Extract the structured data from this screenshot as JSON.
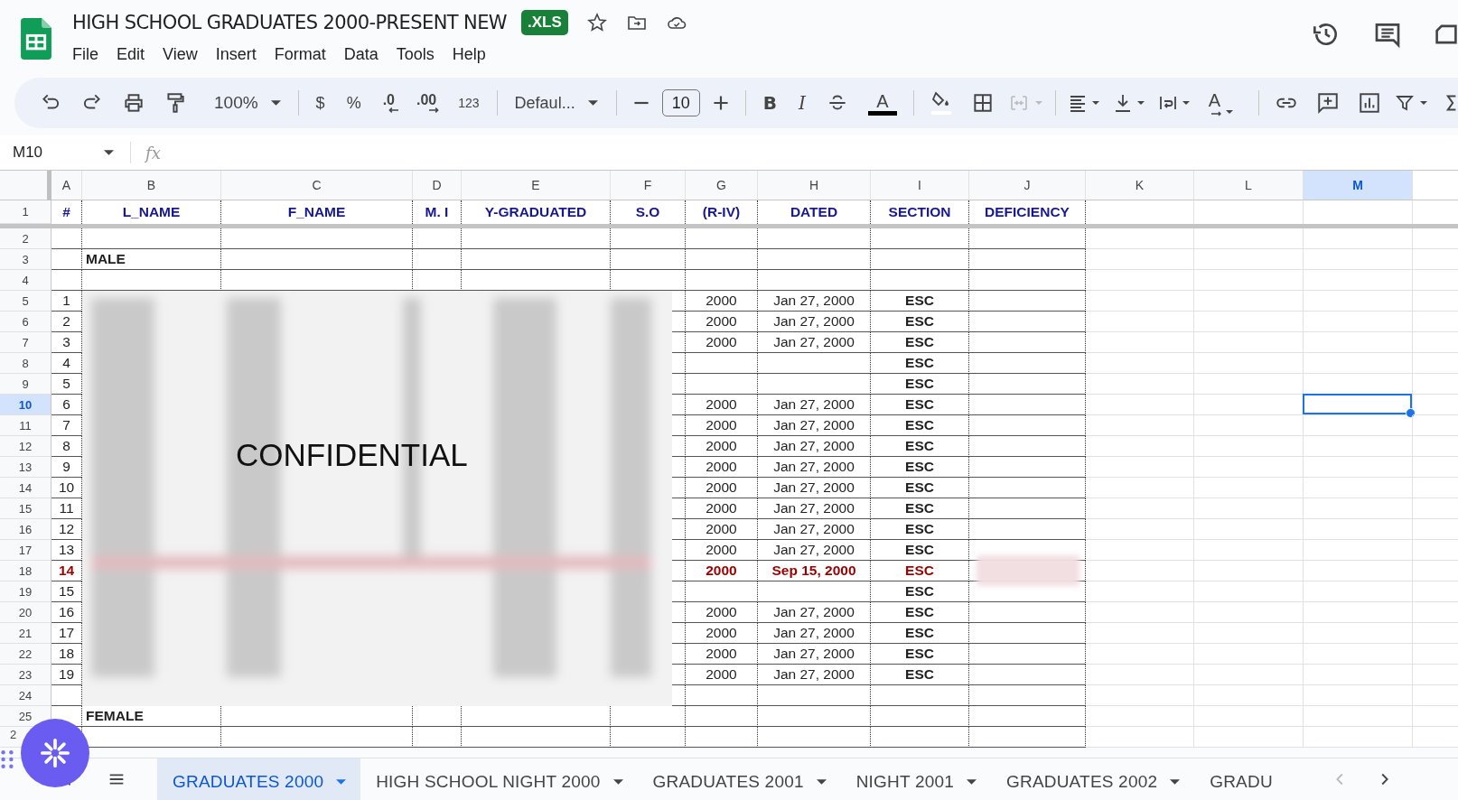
{
  "doc": {
    "title": "HIGH SCHOOL GRADUATES 2000-PRESENT NEW",
    "badge": ".XLS"
  },
  "menu": [
    "File",
    "Edit",
    "View",
    "Insert",
    "Format",
    "Data",
    "Tools",
    "Help"
  ],
  "toolbar": {
    "zoom": "100%",
    "currency": "$",
    "percent": "%",
    "dec_less": ".0",
    "dec_more": ".00",
    "number_format": "123",
    "font": "Defaul...",
    "font_size": "10",
    "bold": "B",
    "italic": "I",
    "text_color": "A",
    "rotate": "A"
  },
  "name_box": "M10",
  "fx": "fx",
  "columns": [
    {
      "letter": "A",
      "selected": false
    },
    {
      "letter": "B",
      "selected": false
    },
    {
      "letter": "C",
      "selected": false
    },
    {
      "letter": "D",
      "selected": false
    },
    {
      "letter": "E",
      "selected": false
    },
    {
      "letter": "F",
      "selected": false
    },
    {
      "letter": "G",
      "selected": false
    },
    {
      "letter": "H",
      "selected": false
    },
    {
      "letter": "I",
      "selected": false
    },
    {
      "letter": "J",
      "selected": false
    },
    {
      "letter": "K",
      "selected": false
    },
    {
      "letter": "L",
      "selected": false
    },
    {
      "letter": "M",
      "selected": true
    }
  ],
  "header_row": {
    "row": "1",
    "cells": [
      "#",
      "L_NAME",
      "F_NAME",
      "M. I",
      "Y-GRADUATED",
      "S.O",
      "(R-IV)",
      "DATED",
      "SECTION",
      "DEFICIENCY"
    ]
  },
  "rows": [
    {
      "row": "2",
      "selected": false,
      "flagged": false
    },
    {
      "row": "3",
      "selected": false,
      "flagged": false,
      "label": "MALE"
    },
    {
      "row": "4",
      "selected": false,
      "flagged": false
    },
    {
      "row": "5",
      "selected": false,
      "flagged": false,
      "num": "1",
      "year": "2000",
      "dated": "Jan 27, 2000",
      "section": "ESC"
    },
    {
      "row": "6",
      "selected": false,
      "flagged": false,
      "num": "2",
      "year": "2000",
      "dated": "Jan 27, 2000",
      "section": "ESC"
    },
    {
      "row": "7",
      "selected": false,
      "flagged": false,
      "num": "3",
      "year": "2000",
      "dated": "Jan 27, 2000",
      "section": "ESC"
    },
    {
      "row": "8",
      "selected": false,
      "flagged": false,
      "num": "4",
      "section": "ESC"
    },
    {
      "row": "9",
      "selected": false,
      "flagged": false,
      "num": "5",
      "section": "ESC"
    },
    {
      "row": "10",
      "selected": true,
      "flagged": false,
      "num": "6",
      "year": "2000",
      "dated": "Jan 27, 2000",
      "section": "ESC"
    },
    {
      "row": "11",
      "selected": false,
      "flagged": false,
      "num": "7",
      "year": "2000",
      "dated": "Jan 27, 2000",
      "section": "ESC"
    },
    {
      "row": "12",
      "selected": false,
      "flagged": false,
      "num": "8",
      "year": "2000",
      "dated": "Jan 27, 2000",
      "section": "ESC"
    },
    {
      "row": "13",
      "selected": false,
      "flagged": false,
      "num": "9",
      "year": "2000",
      "dated": "Jan 27, 2000",
      "section": "ESC"
    },
    {
      "row": "14",
      "selected": false,
      "flagged": false,
      "num": "10",
      "year": "2000",
      "dated": "Jan 27, 2000",
      "section": "ESC"
    },
    {
      "row": "15",
      "selected": false,
      "flagged": false,
      "num": "11",
      "year": "2000",
      "dated": "Jan 27, 2000",
      "section": "ESC"
    },
    {
      "row": "16",
      "selected": false,
      "flagged": false,
      "num": "12",
      "year": "2000",
      "dated": "Jan 27, 2000",
      "section": "ESC"
    },
    {
      "row": "17",
      "selected": false,
      "flagged": false,
      "num": "13",
      "year": "2000",
      "dated": "Jan 27, 2000",
      "section": "ESC"
    },
    {
      "row": "18",
      "selected": false,
      "flagged": true,
      "num": "14",
      "year": "2000",
      "dated": "Sep 15, 2000",
      "section": "ESC"
    },
    {
      "row": "19",
      "selected": false,
      "flagged": false,
      "num": "15",
      "section": "ESC"
    },
    {
      "row": "20",
      "selected": false,
      "flagged": false,
      "num": "16",
      "year": "2000",
      "dated": "Jan 27, 2000",
      "section": "ESC"
    },
    {
      "row": "21",
      "selected": false,
      "flagged": false,
      "num": "17",
      "year": "2000",
      "dated": "Jan 27, 2000",
      "section": "ESC"
    },
    {
      "row": "22",
      "selected": false,
      "flagged": false,
      "num": "18",
      "year": "2000",
      "dated": "Jan 27, 2000",
      "section": "ESC"
    },
    {
      "row": "23",
      "selected": false,
      "flagged": false,
      "num": "19",
      "year": "2000",
      "dated": "Jan 27, 2000",
      "section": "ESC"
    },
    {
      "row": "24",
      "selected": false,
      "flagged": false
    },
    {
      "row": "25",
      "selected": false,
      "flagged": false,
      "label": "FEMALE"
    }
  ],
  "partial_row": "2",
  "redaction": {
    "label": "CONFIDENTIAL"
  },
  "sheets": [
    {
      "name": "GRADUATES 2000",
      "selected": true,
      "caret": true
    },
    {
      "name": "HIGH SCHOOL NIGHT 2000",
      "selected": false,
      "caret": true
    },
    {
      "name": "GRADUATES 2001",
      "selected": false,
      "caret": true
    },
    {
      "name": "NIGHT 2001",
      "selected": false,
      "caret": true
    },
    {
      "name": "GRADUATES 2002",
      "selected": false,
      "caret": true
    },
    {
      "name": "GRADU",
      "selected": false,
      "caret": false
    }
  ]
}
